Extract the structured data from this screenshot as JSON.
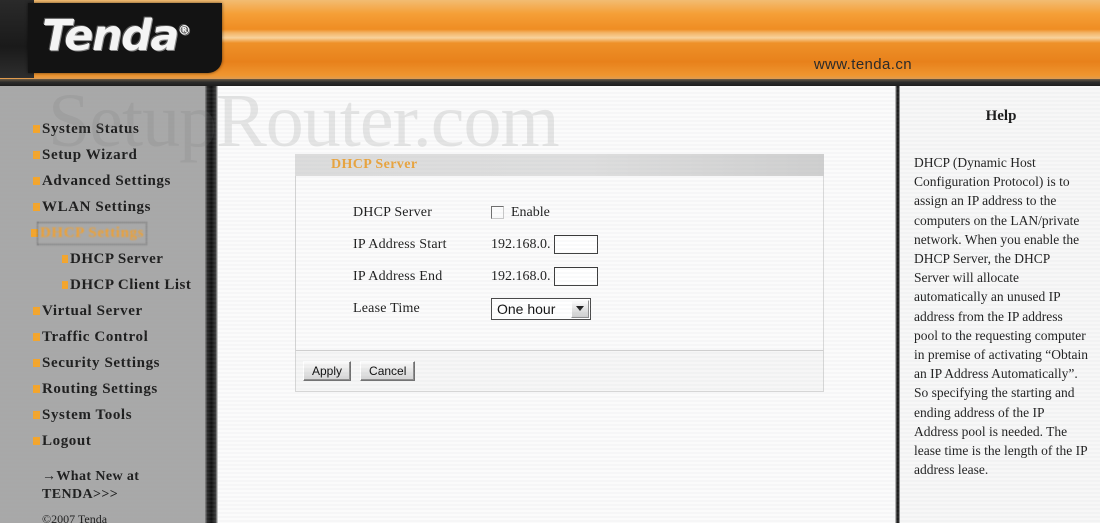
{
  "header": {
    "logo_text": "Tenda",
    "logo_registered": "®",
    "url": "www.tenda.cn"
  },
  "watermark": {
    "text": "SetupRouter.com"
  },
  "sidebar": {
    "items": [
      {
        "label": "System Status",
        "selected": false,
        "sub": false
      },
      {
        "label": "Setup Wizard",
        "selected": false,
        "sub": false
      },
      {
        "label": "Advanced Settings",
        "selected": false,
        "sub": false
      },
      {
        "label": "WLAN Settings",
        "selected": false,
        "sub": false
      },
      {
        "label": "DHCP Settings",
        "selected": true,
        "sub": false
      },
      {
        "label": "DHCP Server",
        "selected": false,
        "sub": true
      },
      {
        "label": "DHCP Client List",
        "selected": false,
        "sub": true
      },
      {
        "label": "Virtual Server",
        "selected": false,
        "sub": false
      },
      {
        "label": "Traffic Control",
        "selected": false,
        "sub": false
      },
      {
        "label": "Security Settings",
        "selected": false,
        "sub": false
      },
      {
        "label": "Routing Settings",
        "selected": false,
        "sub": false
      },
      {
        "label": "System Tools",
        "selected": false,
        "sub": false
      },
      {
        "label": "Logout",
        "selected": false,
        "sub": false
      }
    ],
    "whats_new": "→What New at TENDA>>>",
    "copyright": "©2007 Tenda"
  },
  "main": {
    "panel_title": "DHCP Server",
    "rows": {
      "dhcp_server": {
        "label": "DHCP Server",
        "checkbox_label": "Enable",
        "checked": false
      },
      "ip_start": {
        "label": "IP Address Start",
        "prefix": "192.168.0.",
        "value": ""
      },
      "ip_end": {
        "label": "IP Address End",
        "prefix": "192.168.0.",
        "value": ""
      },
      "lease_time": {
        "label": "Lease Time",
        "selected": "One hour",
        "options": [
          "One hour"
        ]
      }
    },
    "apply_label": "Apply",
    "cancel_label": "Cancel"
  },
  "help": {
    "title": "Help",
    "text": "DHCP (Dynamic Host Configuration Protocol) is to assign an IP address to the computers on the LAN/private network. When you enable the DHCP Server, the DHCP Server will allocate automatically an unused IP address from the IP address pool to the requesting computer in premise of activating “Obtain an IP Address Automatically”. So specifying the starting and ending address of the IP Address pool is needed. The lease time is the length of the IP address lease."
  },
  "colors": {
    "brand_orange": "#ef8d23",
    "accent_orange": "#e8a33d",
    "bullet_orange": "#f5a52a",
    "sidebar_bg": "#a8a8a8"
  }
}
